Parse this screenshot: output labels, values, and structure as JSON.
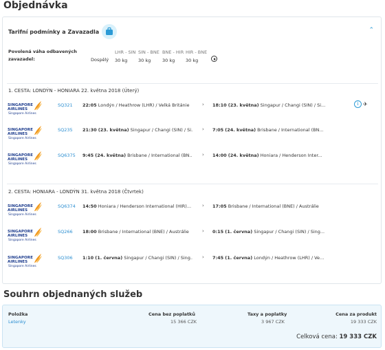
{
  "page_title": "Objednávka",
  "tariff": {
    "title": "Tarifní podmínky a Zavazadla",
    "baggage_label": "Povolená váha odbavených zavazadel:",
    "passenger_type": "Dospělý",
    "legs": [
      {
        "route": "LHR - SIN",
        "weight": "30 kg"
      },
      {
        "route": "SIN - BNE",
        "weight": "30 kg"
      },
      {
        "route": "BNE - HIR",
        "weight": "30 kg"
      },
      {
        "route": "HIR - BNE",
        "weight": "30 kg"
      }
    ]
  },
  "trip1": {
    "title": "1. CESTA: LONDÝN - HONIARA 22. května 2018 (Úterý)",
    "flights": [
      {
        "airline": "Singapore Airlines",
        "number": "SQ321",
        "dep_time": "22:05",
        "dep_place": "Londýn / Heathrow (LHR) / Velká Británie",
        "arr_time": "18:10",
        "arr_date": "(23. května)",
        "arr_place": "Singapur / Changi (SIN) / Si..."
      },
      {
        "airline": "Singapore Airlines",
        "number": "SQ235",
        "dep_time": "21:30",
        "dep_date": "(23. května)",
        "dep_place": "Singapur / Changi (SIN) / Si...",
        "arr_time": "7:05",
        "arr_date": "(24. května)",
        "arr_place": "Brisbane / International (BN..."
      },
      {
        "airline": "Singapore Airlines",
        "number": "SQ6375",
        "dep_time": "9:45",
        "dep_date": "(24. května)",
        "dep_place": "Brisbane / International (BN...",
        "arr_time": "14:00",
        "arr_date": "(24. května)",
        "arr_place": "Honiara / Henderson Inter..."
      }
    ]
  },
  "trip2": {
    "title": "2. CESTA: HONIARA - LONDÝN 31. května 2018 (Čtvrtek)",
    "flights": [
      {
        "airline": "Singapore Airlines",
        "number": "SQ6374",
        "dep_time": "14:50",
        "dep_place": "Honiara / Henderson International (HIR)...",
        "arr_time": "17:05",
        "arr_place": "Brisbane / International (BNE) / Austrálie"
      },
      {
        "airline": "Singapore Airlines",
        "number": "SQ266",
        "dep_time": "18:00",
        "dep_place": "Brisbane / International (BNE) / Austrálie",
        "arr_time": "0:15",
        "arr_date": "(1. června)",
        "arr_place": "Singapur / Changi (SIN) / Sing..."
      },
      {
        "airline": "Singapore Airlines",
        "number": "SQ306",
        "dep_time": "1:10",
        "dep_date": "(1. června)",
        "dep_place": "Singapur / Changi (SIN) / Sing...",
        "arr_time": "7:45",
        "arr_date": "(1. června)",
        "arr_place": "Londýn / Heathrow (LHR) / Ve..."
      }
    ]
  },
  "logo_text": "SINGAPORE AIRLINES",
  "summary": {
    "title": "Souhrn objednaných služeb",
    "headers": {
      "item": "Položka",
      "price": "Cena bez poplatků",
      "taxes": "Taxy a poplatky",
      "product": "Cena za produkt"
    },
    "row": {
      "item": "Letenky",
      "price": "15 366 CZK",
      "taxes": "3 967 CZK",
      "product": "19 333 CZK"
    },
    "total_label": "Celková cena:",
    "total_value": "19 333 CZK"
  },
  "colors": {
    "link": "#2b8ed1",
    "accent_bg": "#eef7fc",
    "brand": "#1a3a8c"
  }
}
